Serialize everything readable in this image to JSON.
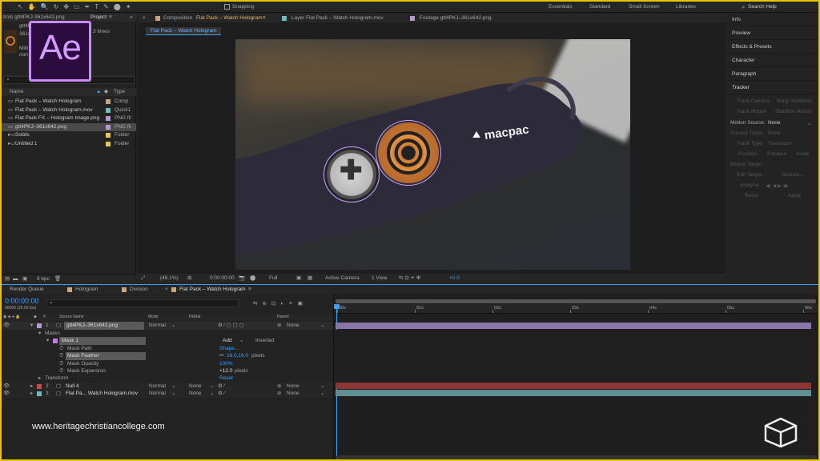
{
  "toolbar": {
    "snapping": "Snapping",
    "workspaces": [
      "Essentials",
      "Standard",
      "Small Screen",
      "Libraries"
    ],
    "search_placeholder": "Search Help"
  },
  "project": {
    "panel_title": "Project",
    "file_name": "trols gtt4PKJ-361x642.png",
    "file_name2": "gtt4PKJ-",
    "file_name3": "361x6",
    "used": "3 times",
    "millions1": "Milli",
    "millions2": "non",
    "col_name": "Name",
    "col_type": "Type",
    "items": [
      {
        "name": "Flat Pack – Watch Hologram",
        "type": "Comp",
        "color": "#c9a77a"
      },
      {
        "name": "Flat Pack – Watch Hologram.mov",
        "type": "Quick1",
        "color": "#6dbcc4"
      },
      {
        "name": "Flat Pack FX – Hologram Image.png",
        "type": "PNG fil",
        "color": "#b39ad4"
      },
      {
        "name": "gtt4PKJ–361x642.png",
        "type": "PNG fil",
        "color": "#b39ad4"
      },
      {
        "name": "Solids",
        "type": "Folder",
        "color": "#e6c84a"
      },
      {
        "name": "Untitled 1",
        "type": "Folder",
        "color": "#e6c84a"
      }
    ],
    "bpc": "8 bpc"
  },
  "ae_logo": "Ae",
  "viewer_tabs": [
    {
      "label": "Composition",
      "name": "Flat Pack – Watch Hologram",
      "color": "#c9a77a"
    },
    {
      "label": "Layer Flat Pack – Watch Hologram.mov",
      "color": "#6dbcc4"
    },
    {
      "label": "Footage gtt4PKJ–361x642.png",
      "color": "#b39ad4"
    }
  ],
  "comp_subtab": "Flat Pack – Watch Hologram",
  "glove_brand": "macpac",
  "viewer_bar": {
    "zoom": "(48.1%)",
    "timecode": "0:00:00:00",
    "resolution": "Full",
    "camera": "Active Camera",
    "view": "1 View",
    "exposure": "+0.0"
  },
  "right_panels": [
    "Info",
    "Preview",
    "Effects & Presets",
    "Character",
    "Paragraph"
  ],
  "tracker": {
    "title": "Tracker",
    "track_camera": "Track Camera",
    "warp_stabilizer": "Warp Stabilizer",
    "track_motion": "Track Motion",
    "stabilize_motion": "Stabilize Motion",
    "motion_source_label": "Motion Source:",
    "motion_source_value": "None",
    "current_track": "Current Track:",
    "current_track_value": "None",
    "track_type": "Track Type:",
    "track_type_value": "Transform",
    "position": "Position",
    "rotation": "Rotation",
    "scale": "Scale",
    "motion_target": "Motion Target:",
    "edit_target": "Edit Target...",
    "options": "Options...",
    "analyze": "Analyze:",
    "reset": "Reset",
    "apply": "Apply"
  },
  "timeline_tabs": [
    {
      "label": "Render Queue",
      "color": ""
    },
    {
      "label": "Hologram",
      "color": "#c9a77a"
    },
    {
      "label": "Division",
      "color": "#c9a77a"
    },
    {
      "label": "Flat Pack – Watch Hologram",
      "color": "#c9a77a"
    }
  ],
  "timecode": "0:00:00:00",
  "timecode_sub": "00000 (25.00 fps)",
  "columns": {
    "source_name": "Source Name",
    "mode": "Mode",
    "trkmat": "TrkMat",
    "parent": "Parent"
  },
  "layers": [
    {
      "num": "1",
      "name": "gtt4PKJ–361x642.png",
      "mode": "Normal",
      "trkmat": "",
      "parent": "None",
      "color": "#b39ad4"
    },
    {
      "num": "2",
      "name": "Null 4",
      "mode": "Normal",
      "trkmat": "None",
      "parent": "None",
      "color": "#c84a4a"
    },
    {
      "num": "3",
      "name": "Flat Pa... Watch Hologram.mov",
      "mode": "Normal",
      "trkmat": "None",
      "parent": "None",
      "color": "#6dbcc4"
    }
  ],
  "masks": {
    "group": "Masks",
    "mask1": "Mask 1",
    "add": "Add",
    "inverted": "Inverted",
    "path": "Mask Path",
    "path_value": "Shape...",
    "feather": "Mask Feather",
    "feather_value": "16.0,16.0",
    "feather_unit": "pixels",
    "opacity": "Mask Opacity",
    "opacity_value": "100%",
    "expansion": "Mask Expansion",
    "expansion_value": "+12.0",
    "expansion_unit": "pixels",
    "transform": "Transform",
    "transform_reset": "Reset"
  },
  "ruler": [
    "00s",
    "01s",
    "02s",
    "03s",
    "04s",
    "05s",
    "06s"
  ],
  "watermark": "www.heritagechristiancollege.com"
}
